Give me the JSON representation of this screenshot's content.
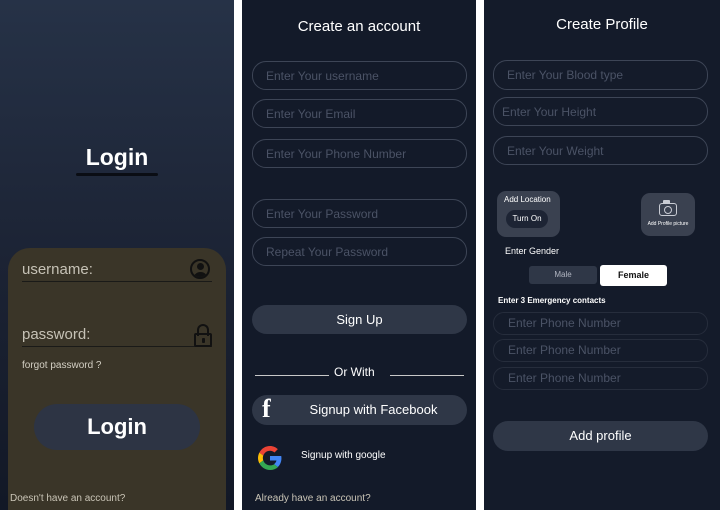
{
  "login_screen": {
    "title": "Login",
    "username_label": "username:",
    "password_label": "password:",
    "forgot_password": "forgot password ?",
    "login_button": "Login",
    "no_account_text": "Doesn't have an account?",
    "icons": [
      "user-icon",
      "lock-icon"
    ],
    "colors": {
      "background": "#1b2233",
      "card": "#3a3528",
      "button": "#2d3444"
    }
  },
  "signup_screen": {
    "title": "Create an account",
    "fields": {
      "username_placeholder": "Enter Your username",
      "email_placeholder": "Enter Your Email",
      "phone_placeholder": "Enter Your Phone Number",
      "password_placeholder": "Enter Your Password",
      "repeat_password_placeholder": "Repeat Your Password"
    },
    "signup_button": "Sign Up",
    "or_with": "Or With",
    "facebook_button": "Signup with Facebook",
    "google_button": "Signup with google",
    "already_account_text": "Already have an account?",
    "icons": [
      "facebook-icon",
      "google-icon"
    ],
    "colors": {
      "background": "#131a29",
      "button": "#2f3747"
    }
  },
  "profile_screen": {
    "title": "Create Profile",
    "fields": {
      "blood_type_placeholder": "Enter Your Blood type",
      "height_placeholder": "Enter Your Height",
      "weight_placeholder": "Enter Your Weight"
    },
    "add_location_label": "Add Location",
    "turn_on_button": "Turn On",
    "add_picture_label": "Add Profile picture",
    "gender_label": "Enter Gender",
    "gender_options": {
      "male": "Male",
      "female": "Female"
    },
    "gender_selected": "Female",
    "emergency_label": "Enter 3 Emergency contacts",
    "emergency_placeholders": [
      "Enter Phone Number",
      "Enter Phone Number",
      "Enter Phone Number"
    ],
    "add_profile_button": "Add profile",
    "icons": [
      "camera-icon"
    ],
    "colors": {
      "background": "#141b2a",
      "selected_toggle": "#ffffff"
    }
  }
}
